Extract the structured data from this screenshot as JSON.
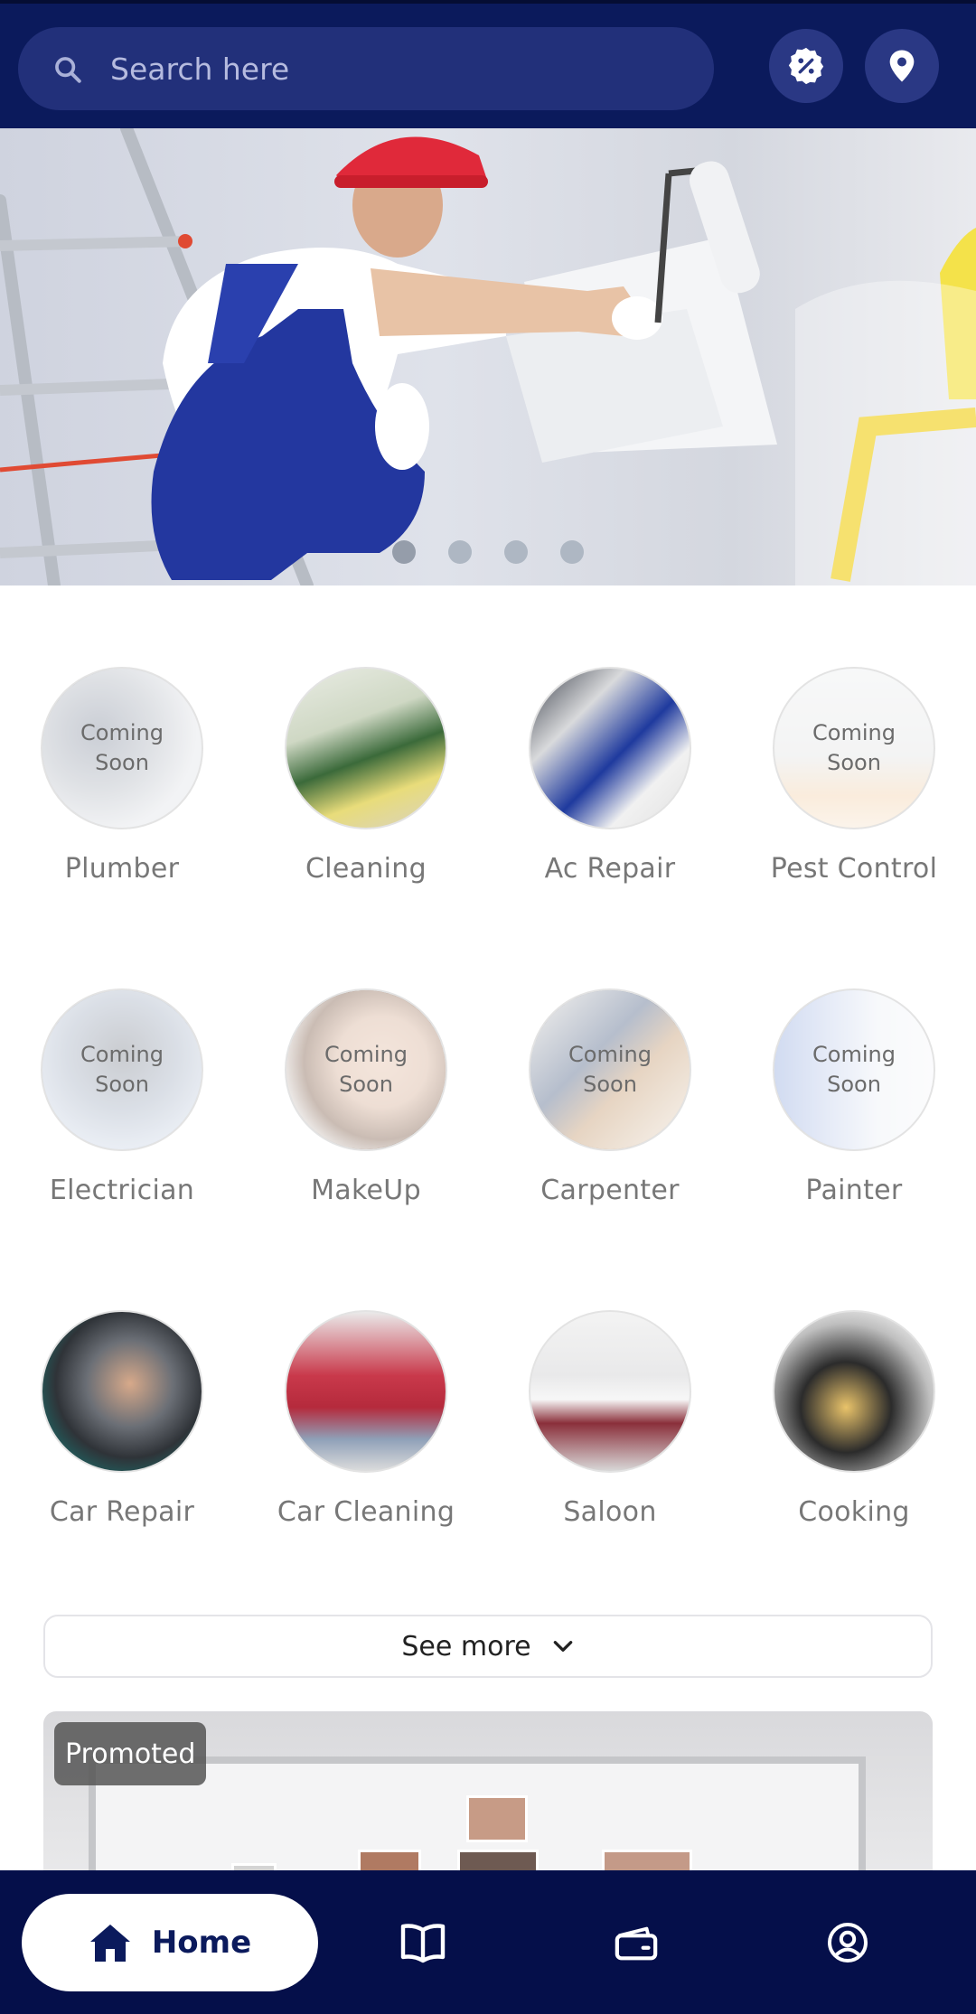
{
  "search": {
    "placeholder": "Search here"
  },
  "header_icons": [
    "discount-badge-icon",
    "location-pin-icon"
  ],
  "banner": {
    "slides": 4,
    "active_slide": 1
  },
  "categories": [
    {
      "label": "Plumber",
      "coming_soon": "Coming\nSoon"
    },
    {
      "label": "Cleaning"
    },
    {
      "label": "Ac Repair"
    },
    {
      "label": "Pest Control",
      "coming_soon": "Coming\nSoon"
    },
    {
      "label": "Electrician",
      "coming_soon": "Coming\nSoon"
    },
    {
      "label": "MakeUp",
      "coming_soon": "Coming\nSoon"
    },
    {
      "label": "Carpenter",
      "coming_soon": "Coming\nSoon"
    },
    {
      "label": "Painter",
      "coming_soon": "Coming\nSoon"
    },
    {
      "label": "Car Repair"
    },
    {
      "label": "Car Cleaning"
    },
    {
      "label": "Saloon"
    },
    {
      "label": "Cooking"
    }
  ],
  "see_more": {
    "label": "See more"
  },
  "promo": {
    "badge": "Promoted"
  },
  "nav": {
    "home_label": "Home",
    "items": [
      "home-icon",
      "book-icon",
      "wallet-icon",
      "profile-icon"
    ]
  },
  "colors": {
    "header": "#0b1a5c",
    "nav": "#050f4a",
    "accent_text": "#0b1a5c"
  }
}
